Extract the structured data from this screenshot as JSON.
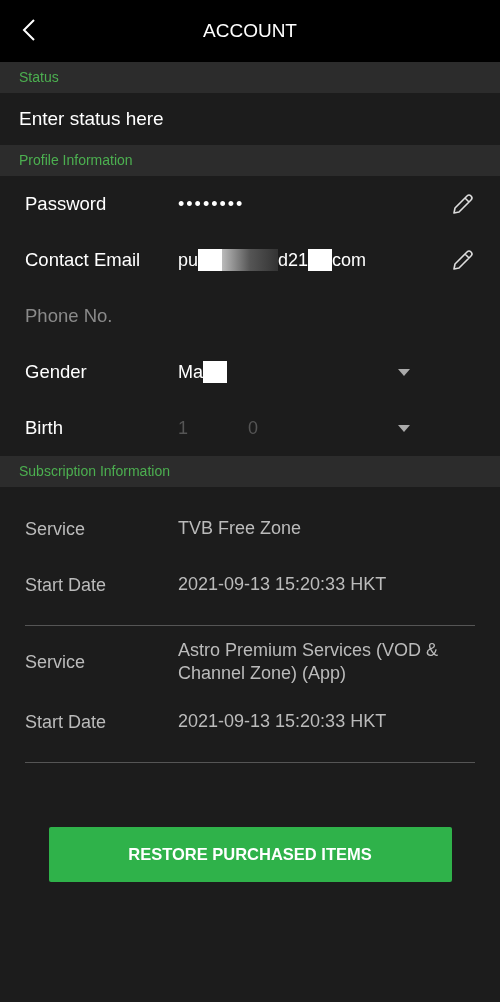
{
  "header": {
    "title": "ACCOUNT"
  },
  "sections": [
    {
      "title": "Status"
    },
    {
      "title": "Profile Information"
    },
    {
      "title": "Subscription Information"
    }
  ],
  "status": {
    "placeholder": "Enter status here"
  },
  "profile": [
    {
      "kind": "password",
      "label": "Password",
      "value": "••••••••",
      "editable": true
    },
    {
      "kind": "redacted",
      "label": "Contact Email",
      "fragments": [
        "pu",
        "d21",
        "com"
      ],
      "editable": true
    },
    {
      "kind": "empty",
      "label": "Phone No.",
      "editable": false
    },
    {
      "kind": "select",
      "label": "Gender",
      "fragments": [
        "Ma"
      ],
      "dim": false
    },
    {
      "kind": "select",
      "label": "Birth",
      "fragments": [
        "1",
        "0"
      ],
      "dim": true
    }
  ],
  "subscriptions": [
    {
      "service": {
        "label": "Service",
        "value": "TVB Free Zone"
      },
      "start": {
        "label": "Start Date",
        "value": "2021-09-13 15:20:33 HKT"
      }
    },
    {
      "service": {
        "label": "Service",
        "value": "Astro Premium Services (VOD & Channel Zone) (App)"
      },
      "start": {
        "label": "Start Date",
        "value": "2021-09-13 15:20:33 HKT"
      }
    }
  ],
  "restore_button": "RESTORE PURCHASED ITEMS"
}
